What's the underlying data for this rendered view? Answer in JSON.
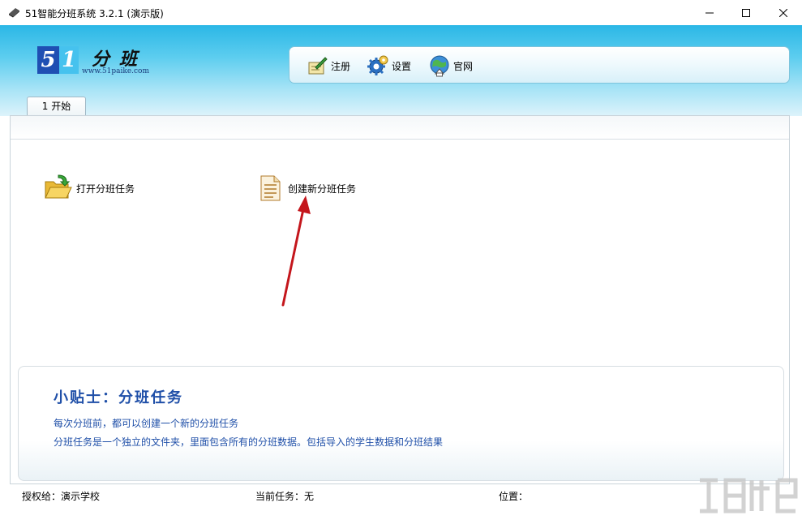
{
  "window": {
    "title": "51智能分班系统 3.2.1 (演示版)",
    "controls": [
      "minimize",
      "maximize",
      "close"
    ]
  },
  "logo": {
    "digit1": "5",
    "digit2": "1",
    "name": "分班",
    "url": "www.51paike.com"
  },
  "toolbar": {
    "register_label": "注册",
    "settings_label": "设置",
    "website_label": "官网"
  },
  "tabs": [
    {
      "label": "1 开始"
    }
  ],
  "actions": {
    "open_label": "打开分班任务",
    "create_label": "创建新分班任务"
  },
  "tips": {
    "heading": "小贴士：分班任务",
    "line1": "每次分班前，都可以创建一个新的分班任务",
    "line2": "分班任务是一个独立的文件夹，里面包含所有的分班数据。包括导入的学生数据和分班结果"
  },
  "status": {
    "licensed": "授权给：演示学校",
    "current_task": "当前任务：无",
    "location": "位置："
  },
  "colors": {
    "header_top": "#2bb7e6",
    "tips_text": "#1f4fa8",
    "arrow": "#c4161c"
  }
}
